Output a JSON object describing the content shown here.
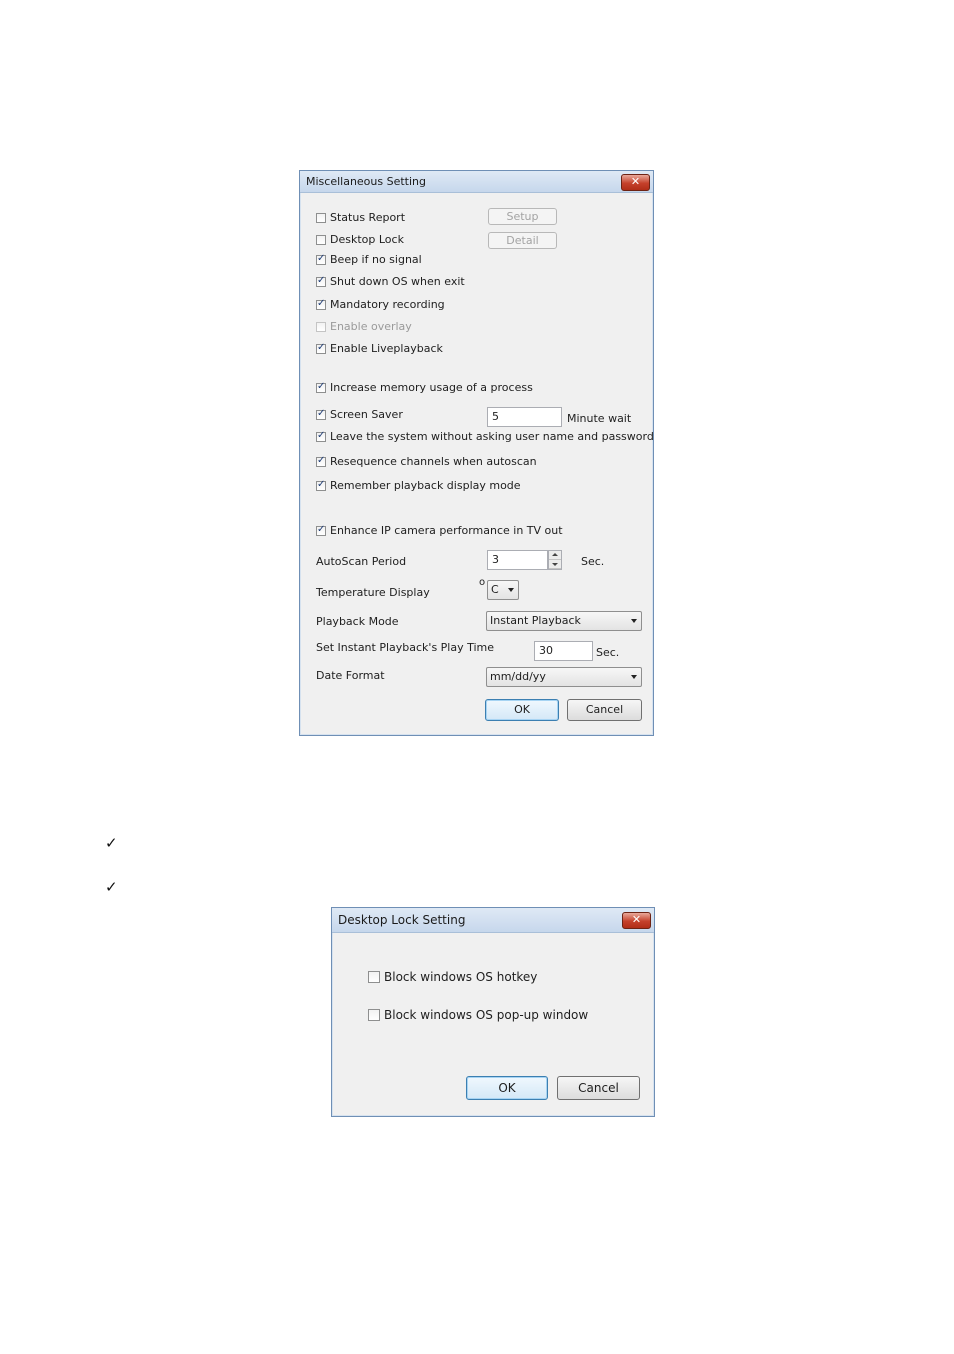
{
  "misc_dialog": {
    "title": "Miscellaneous Setting",
    "close_glyph": "✕",
    "options": [
      {
        "label": "Status Report",
        "checked": false,
        "enabled": true
      },
      {
        "label": "Desktop Lock",
        "checked": false,
        "enabled": true
      },
      {
        "label": "Beep if no signal",
        "checked": true,
        "enabled": true
      },
      {
        "label": "Shut down OS when exit",
        "checked": true,
        "enabled": true
      },
      {
        "label": "Mandatory recording",
        "checked": true,
        "enabled": true
      },
      {
        "label": "Enable overlay",
        "checked": false,
        "enabled": false
      },
      {
        "label": "Enable Liveplayback",
        "checked": true,
        "enabled": true
      },
      {
        "label": "Increase memory usage of a process",
        "checked": true,
        "enabled": true
      },
      {
        "label": "Screen Saver",
        "checked": true,
        "enabled": true
      },
      {
        "label": "Leave the system without asking user name and password",
        "checked": true,
        "enabled": true
      },
      {
        "label": "Resequence channels when autoscan",
        "checked": true,
        "enabled": true
      },
      {
        "label": "Remember playback display mode",
        "checked": true,
        "enabled": true
      },
      {
        "label": "Enhance IP camera performance in TV out",
        "checked": true,
        "enabled": true
      }
    ],
    "setup_button": "Setup",
    "detail_button": "Detail",
    "screen_saver_value": "5",
    "screen_saver_unit": "Minute wait",
    "autoscan_label": "AutoScan Period",
    "autoscan_value": "3",
    "autoscan_unit": "Sec.",
    "temperature_label": "Temperature Display",
    "temperature_degree": "o",
    "temperature_value": "C",
    "playback_mode_label": "Playback Mode",
    "playback_mode_value": "Instant Playback",
    "instant_time_label": "Set Instant Playback's Play Time",
    "instant_time_value": "30",
    "instant_time_unit": "Sec.",
    "date_format_label": "Date Format",
    "date_format_value": "mm/dd/yy",
    "ok_button": "OK",
    "cancel_button": "Cancel"
  },
  "bullets": [
    "✓",
    "✓"
  ],
  "lock_dialog": {
    "title": "Desktop Lock Setting",
    "close_glyph": "✕",
    "options": [
      {
        "label": "Block windows OS hotkey",
        "checked": false
      },
      {
        "label": "Block windows OS pop-up window",
        "checked": false
      }
    ],
    "ok_button": "OK",
    "cancel_button": "Cancel"
  }
}
